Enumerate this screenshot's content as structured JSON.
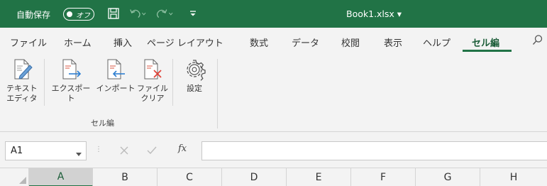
{
  "titlebar": {
    "autosave_label": "自動保存",
    "autosave_state": "オフ",
    "document_title": "Book1.xlsx ▾",
    "bg_color": "#217346",
    "icons": [
      "save-icon",
      "undo-icon",
      "redo-icon",
      "customize-qat-icon"
    ]
  },
  "tabs": [
    {
      "label": "ファイル"
    },
    {
      "label": "ホーム"
    },
    {
      "label": "挿入"
    },
    {
      "label": "ページ レイアウト"
    },
    {
      "label": "数式"
    },
    {
      "label": "データ"
    },
    {
      "label": "校閲"
    },
    {
      "label": "表示"
    },
    {
      "label": "ヘルプ"
    },
    {
      "label": "セル編",
      "active": true
    }
  ],
  "ribbon": {
    "buttons": [
      {
        "label": "テキスト\nエディタ",
        "icon": "text-editor-icon"
      },
      {
        "label": "エクスポート",
        "icon": "export-icon"
      },
      {
        "label": "インポート",
        "icon": "import-icon"
      },
      {
        "label": "ファイル\nクリア",
        "icon": "file-clear-icon"
      },
      {
        "label": "設定",
        "icon": "settings-gear-icon"
      }
    ],
    "group_label": "セル編"
  },
  "formula_bar": {
    "name_box_value": "A1",
    "fx_label": "fx",
    "formula_value": ""
  },
  "columns": [
    "A",
    "B",
    "C",
    "D",
    "E",
    "F",
    "G",
    "H"
  ],
  "accent_color": "#217346"
}
